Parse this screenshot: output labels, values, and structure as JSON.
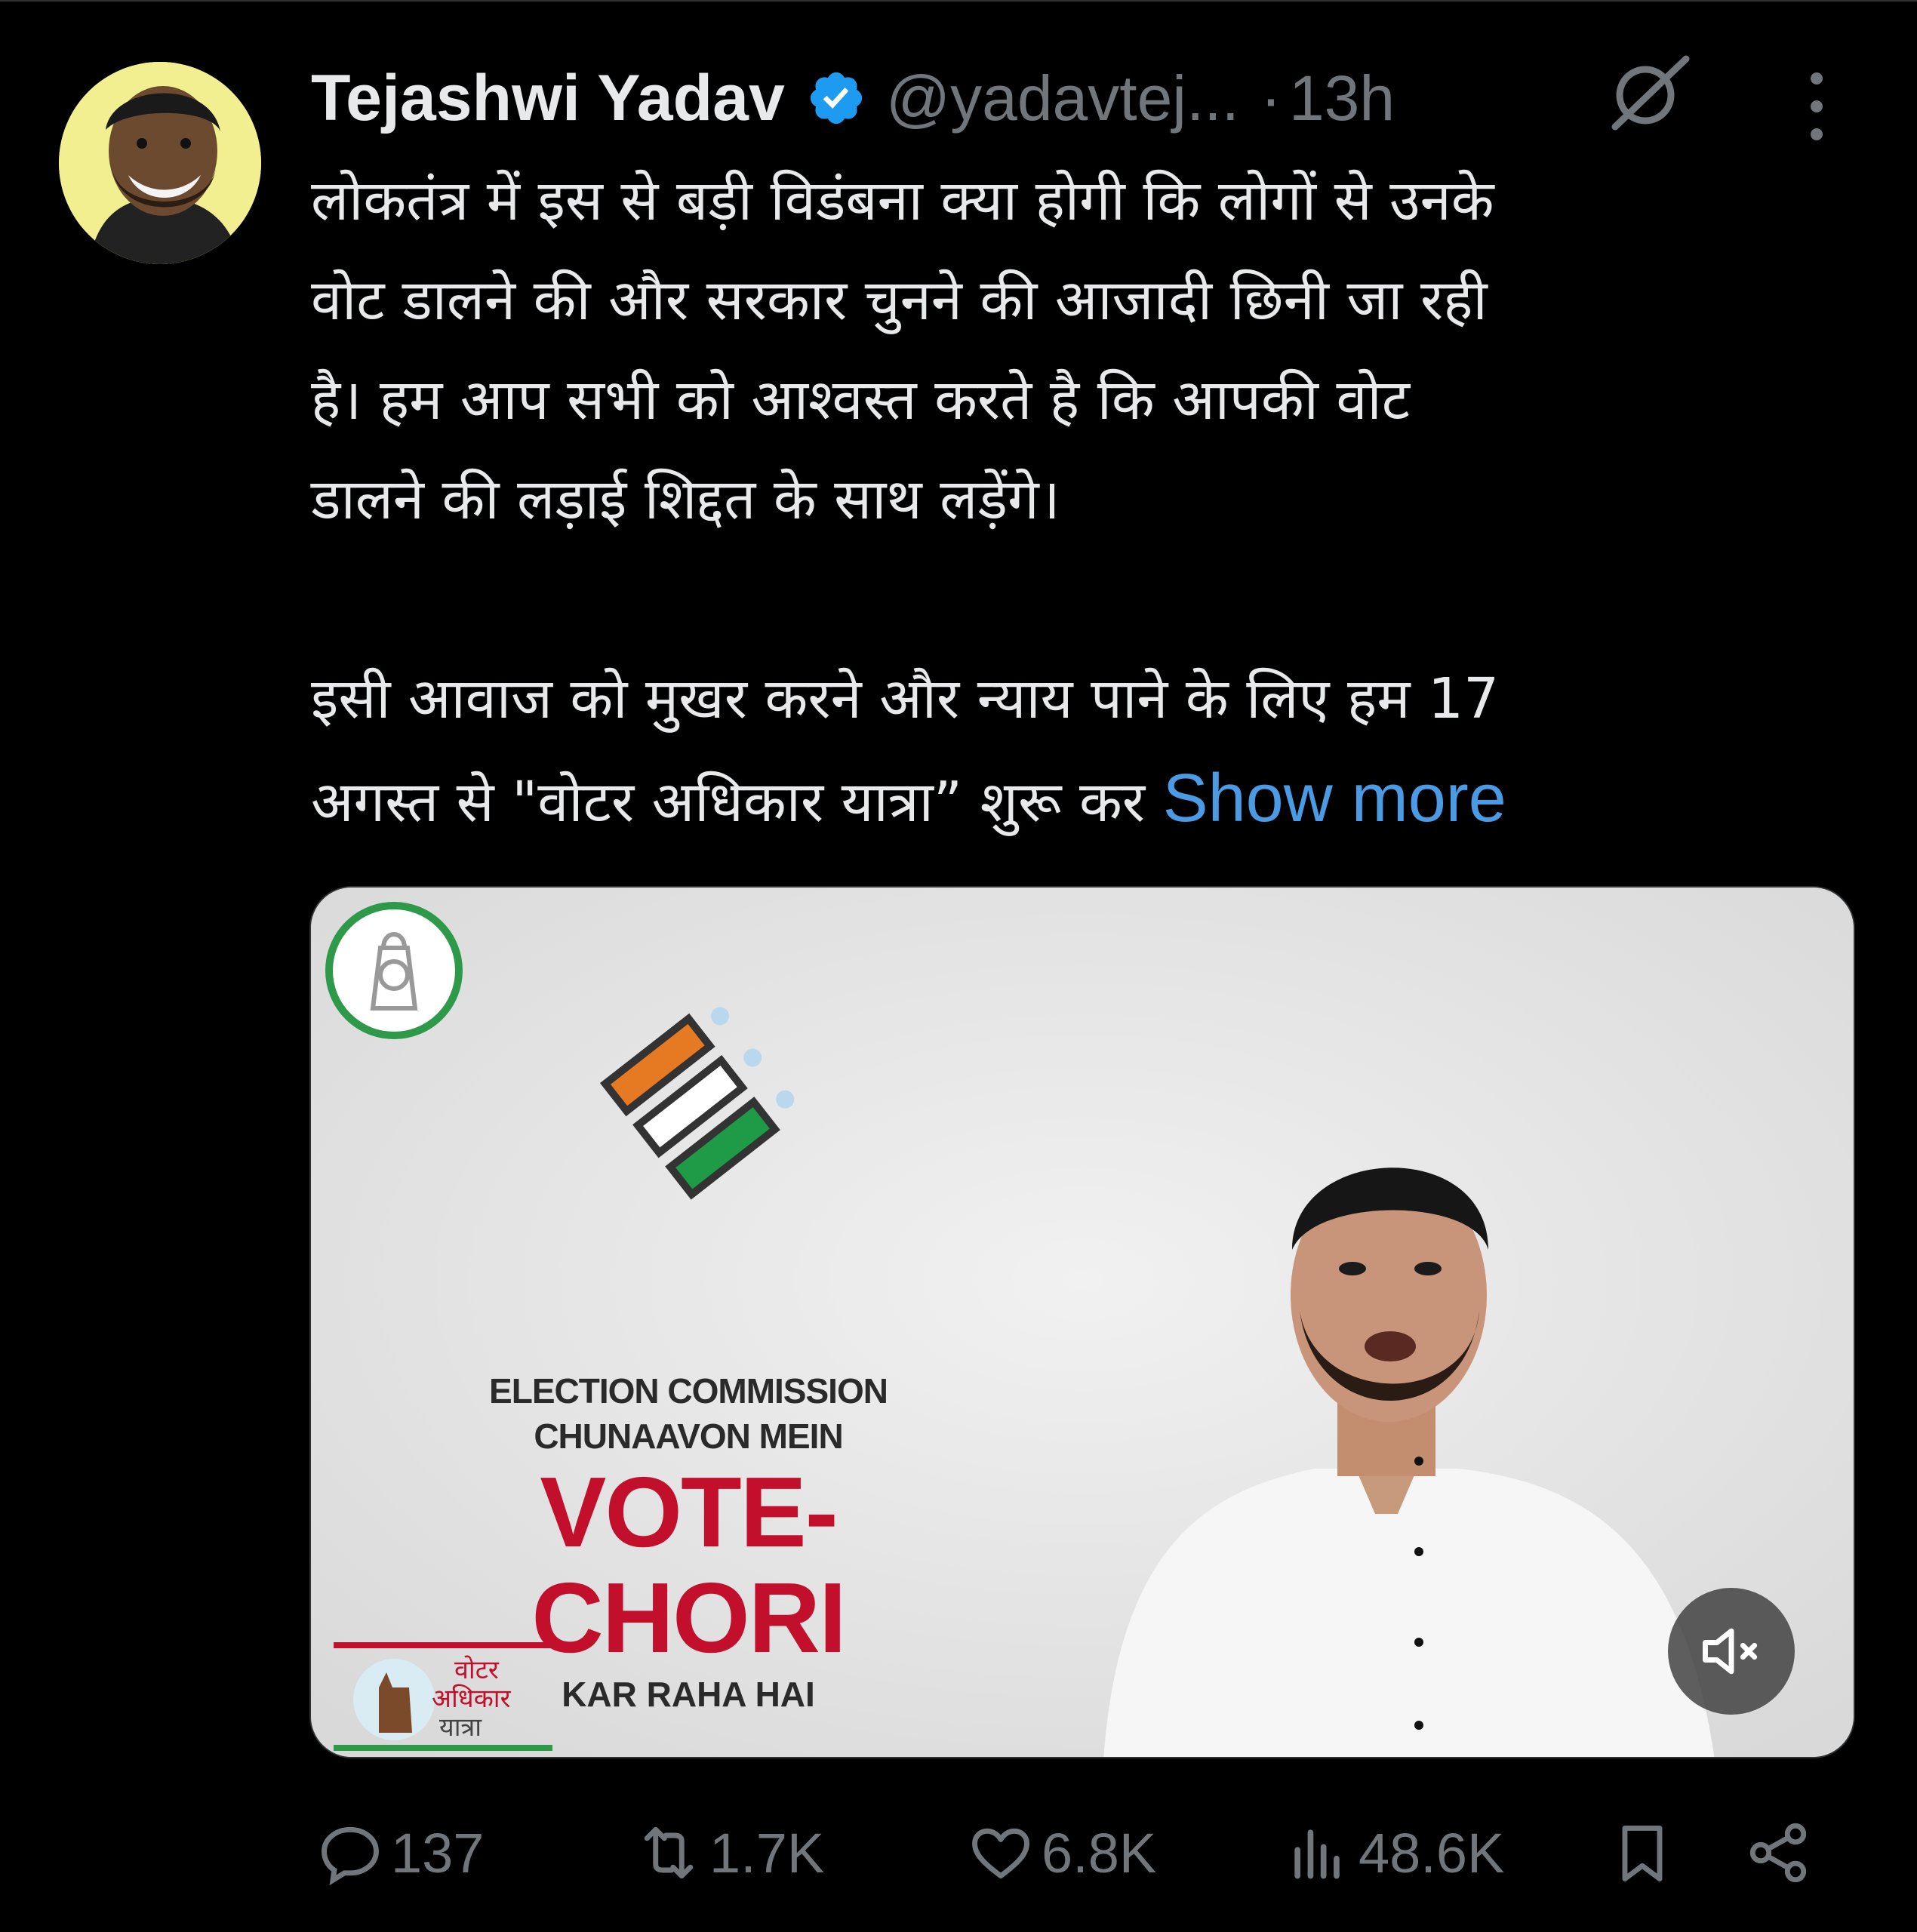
{
  "tweet": {
    "author_name": "Tejashwi Yadav",
    "handle": "@yadavtej...",
    "separator": "·",
    "time": "13h",
    "text_lines": [
      "लोकतंत्र में इस से बड़ी विडंबना क्या होगी कि लोगों से उनके",
      "वोट डालने की और सरकार चुनने की आजादी छिनी जा रही",
      "है। हम आप सभी को आश्वस्त करते है कि आपकी वोट",
      "डालने की लड़ाई शिद्दत के साथ लड़ेंगे।",
      "",
      "इसी आवाज को मुखर करने और न्याय पाने के लिए हम 17",
      "अगस्त से \"वोटर अधिकार यात्रा” शुरू कर"
    ],
    "show_more": "Show more"
  },
  "media": {
    "line1": "ELECTION COMMISSION",
    "line2": "CHUNAAVON MEIN",
    "line3": "VOTE-CHORI",
    "line4": "KAR RAHA HAI",
    "corner_logo_text": [
      "वोटर",
      "अधिकार",
      "यात्रा"
    ],
    "mute_icon": "speaker-muted-icon"
  },
  "actions": {
    "replies": "137",
    "reposts": "1.7K",
    "likes": "6.8K",
    "views": "48.6K"
  },
  "colors": {
    "background": "#000000",
    "text": "#e7e9ea",
    "muted": "#71767b",
    "link": "#4a9ae4",
    "verified": "#1d9bf0",
    "vote_chori_red": "#c2102c"
  }
}
